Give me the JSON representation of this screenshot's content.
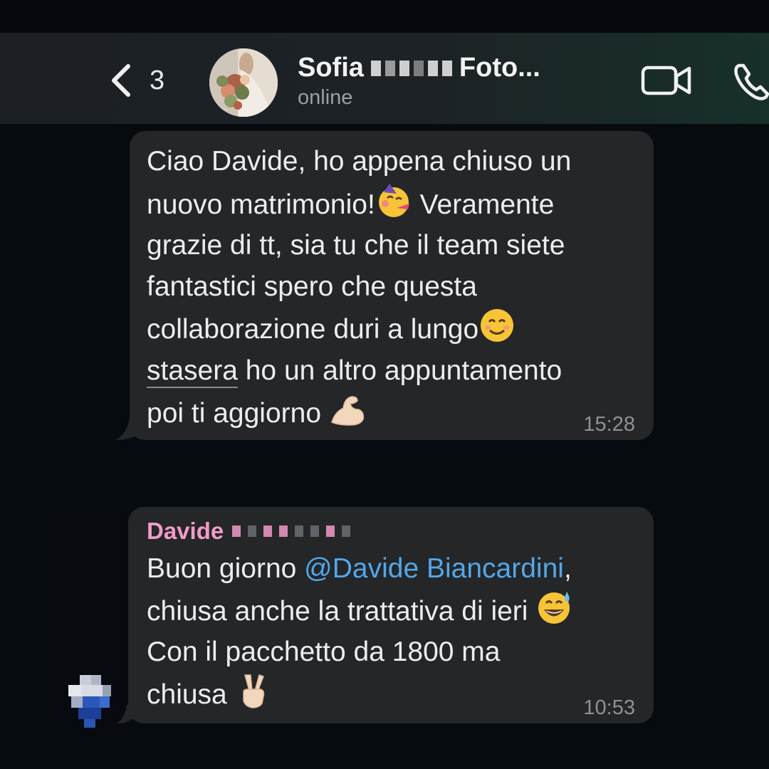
{
  "header": {
    "back_count": "3",
    "contact_name_prefix": "Sofia",
    "contact_name_suffix": "Foto...",
    "status": "online"
  },
  "messages": [
    {
      "line1": "Ciao Davide, ho appena chiuso un",
      "line2a": "nuovo matrimonio!",
      "line2b": " Veramente",
      "line3": "grazie di tt, sia tu che il team siete",
      "line4": "fantastici spero che questa",
      "line5": "collaborazione duri a lungo",
      "line6a": "stasera",
      "line6b": " ho un altro appuntamento",
      "line7": "poi ti aggiorno ",
      "time": "15:28"
    },
    {
      "sender": "Davide",
      "line1a": "Buon giorno ",
      "mention": "@Davide Biancardini",
      "line1b": ",",
      "line2": "chiusa anche la trattativa di ieri ",
      "line3": "Con il pacchetto da 1800 ma",
      "line4": "chiusa ",
      "time": "10:53"
    }
  ],
  "icons": {
    "back": "chevron-left-icon",
    "video": "video-camera-icon",
    "call": "phone-icon",
    "emoji1": "partying-face-emoji",
    "emoji2": "smiling-face-emoji",
    "emoji3": "flexed-biceps-emoji",
    "emoji4": "grinning-sweat-emoji",
    "emoji5": "victory-hand-emoji"
  },
  "colors": {
    "background": "#060b10",
    "header": "#1c2025",
    "bubble": "#242628",
    "sender": "#f19ac8",
    "mention": "#53a7e8",
    "timestamp": "#8e9297"
  }
}
